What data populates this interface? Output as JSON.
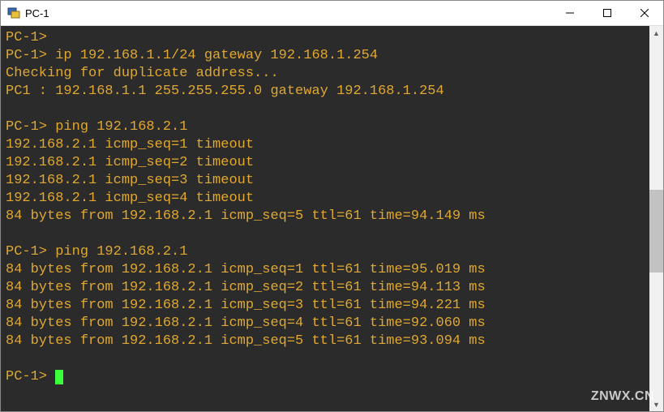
{
  "titlebar": {
    "title": "PC-1"
  },
  "terminal": {
    "lines": [
      "PC-1>",
      "PC-1> ip 192.168.1.1/24 gateway 192.168.1.254",
      "Checking for duplicate address...",
      "PC1 : 192.168.1.1 255.255.255.0 gateway 192.168.1.254",
      "",
      "PC-1> ping 192.168.2.1",
      "192.168.2.1 icmp_seq=1 timeout",
      "192.168.2.1 icmp_seq=2 timeout",
      "192.168.2.1 icmp_seq=3 timeout",
      "192.168.2.1 icmp_seq=4 timeout",
      "84 bytes from 192.168.2.1 icmp_seq=5 ttl=61 time=94.149 ms",
      "",
      "PC-1> ping 192.168.2.1",
      "84 bytes from 192.168.2.1 icmp_seq=1 ttl=61 time=95.019 ms",
      "84 bytes from 192.168.2.1 icmp_seq=2 ttl=61 time=94.113 ms",
      "84 bytes from 192.168.2.1 icmp_seq=3 ttl=61 time=94.221 ms",
      "84 bytes from 192.168.2.1 icmp_seq=4 ttl=61 time=92.060 ms",
      "84 bytes from 192.168.2.1 icmp_seq=5 ttl=61 time=93.094 ms",
      "",
      "PC-1> "
    ]
  },
  "watermark": "ZNWX.CN"
}
